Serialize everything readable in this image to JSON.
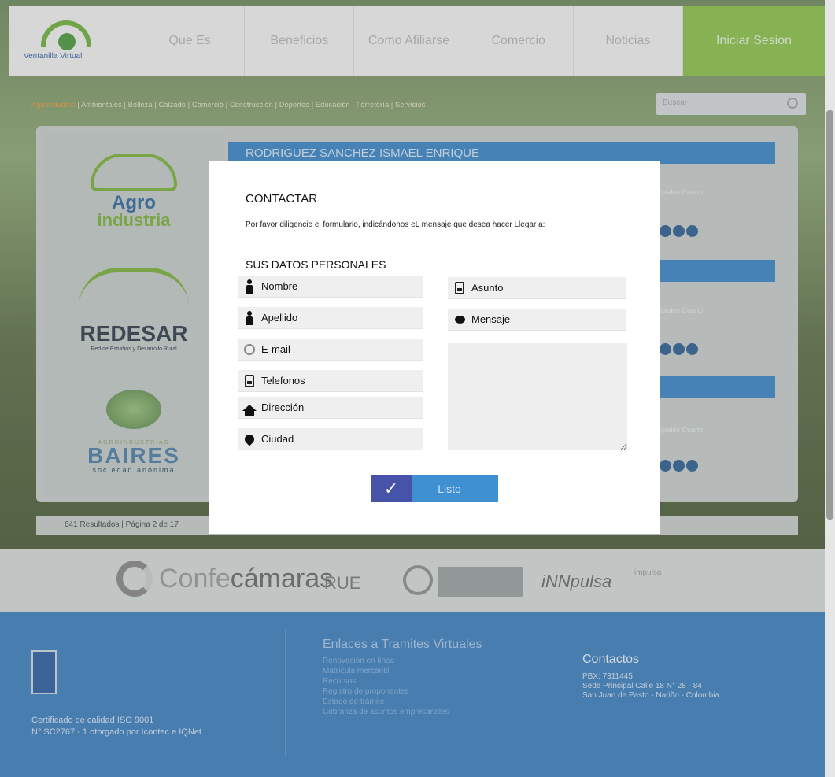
{
  "nav": {
    "logo_text": "Ventanilla Virtual",
    "items": [
      "Que Es",
      "Beneficios",
      "Como Afiliarse",
      "Comercio",
      "Noticias"
    ],
    "login": "Iniciar Sesion"
  },
  "background": {
    "breadcrumb_highlight": "Agroindustria",
    "breadcrumb_rest": " | Ambientales | Belleza | Calzado | Comercio | Construcción | Deportes | Educación | Ferretería | Servicios",
    "search_placeholder": "Buscar",
    "row_headers": [
      "RODRIGUEZ SANCHEZ ISMAEL ENRIQUE",
      "",
      ""
    ],
    "right_info": [
      "Ipiales Cuarto",
      "Ipiales Cuarto",
      "Ipiales Cuarto"
    ],
    "brands": {
      "agro_1": "Agro",
      "agro_2": "industria",
      "redesar": "REDESAR",
      "redesar_sub": "Red de Estudios y Desarrollo Rural",
      "baires_top": "AGROINDUSTRIAS",
      "baires": "BAIRES",
      "baires_sub": "sociedad anónima"
    },
    "pagination": "641 Resultados | Página 2 de 17"
  },
  "partners": {
    "confe_a": "Confe",
    "confe_b": "cámaras",
    "rue": "RUE",
    "nnpulsa": "iNNpulsa",
    "impulsa": "impulsa"
  },
  "footer": {
    "cert_line1": "Certificado de calidad ISO 9001",
    "cert_line2": "N° SC2767 - 1 otorgado por Icontec e IQNet",
    "links_title": "Enlaces a Tramites Virtuales",
    "links": [
      "Renovación en línea",
      "Matrícula mercantil",
      "Recursos",
      "Registro de proponentes",
      "Estado de trámite",
      "Cobranza de asuntos empresariales"
    ],
    "contact_title": "Contactos",
    "contact_pbx": "PBX: 7311445",
    "contact_addr1": "Sede Principal Calle 18 N° 28 - 84",
    "contact_addr2": "San Juan de Pasto - Nariño - Colombia"
  },
  "modal": {
    "title": "CONTACTAR",
    "description": "Por favor diligencie el formulario, indicándonos eL mensaje que desea hacer Llegar a:",
    "section": "SUS DATOS PERSONALES",
    "fields": {
      "nombre": "Nombre",
      "apellido": "Apellido",
      "email": "E-mail",
      "telefonos": "Telefonos",
      "direccion": "Dirección",
      "ciudad": "Ciudad",
      "asunto": "Asunto",
      "mensaje": "Mensaje"
    },
    "submit": "Listo",
    "submit_icon": "✓"
  },
  "icons": {
    "person": "person-icon",
    "email": "at-sign-icon",
    "phone": "phone-icon",
    "home": "home-icon",
    "location": "location-pin-icon",
    "message": "speech-bubble-icon"
  },
  "colors": {
    "accent_green": "#8bc34a",
    "header_blue": "#3a86c8",
    "footer_blue": "#3b7fc1",
    "button_blue": "#3f8fd3",
    "button_check": "#4653a8"
  }
}
